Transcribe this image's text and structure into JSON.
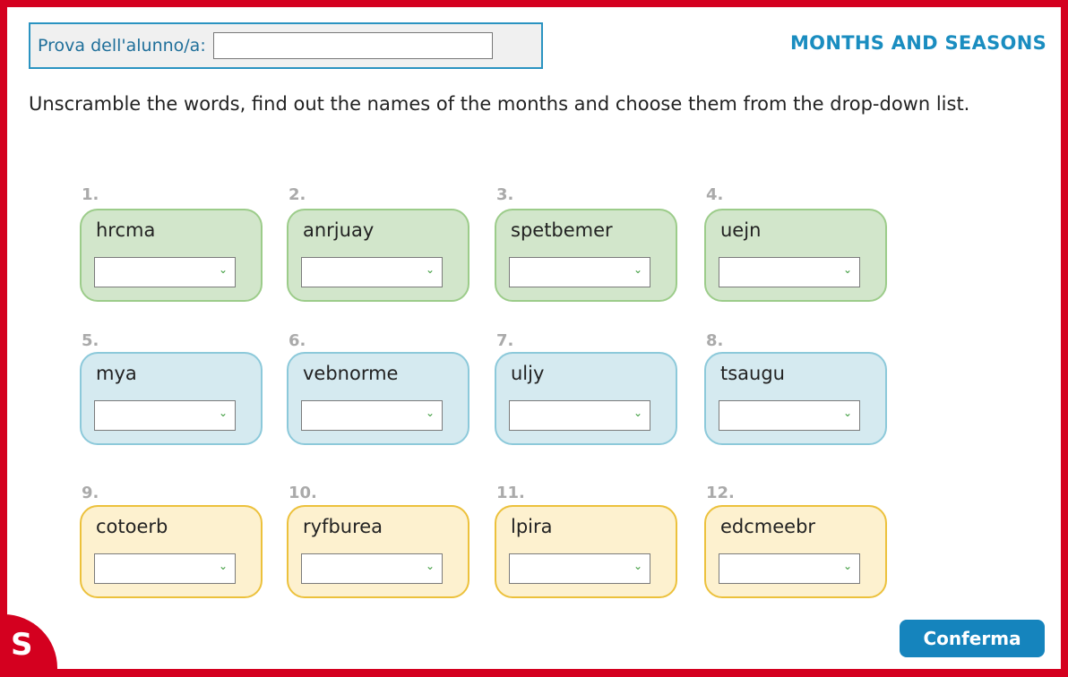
{
  "header": {
    "student_label": "Prova dell'alunno/a:",
    "student_value": "",
    "title": "MONTHS AND SEASONS"
  },
  "instruction": "Unscramble the words, find out the names of the months and choose them from the drop-down list.",
  "items": [
    {
      "num": "1.",
      "word": "hrcma",
      "selected": ""
    },
    {
      "num": "2.",
      "word": "anrjuay",
      "selected": ""
    },
    {
      "num": "3.",
      "word": "spetbemer",
      "selected": ""
    },
    {
      "num": "4.",
      "word": "uejn",
      "selected": ""
    },
    {
      "num": "5.",
      "word": "mya",
      "selected": ""
    },
    {
      "num": "6.",
      "word": "vebnorme",
      "selected": ""
    },
    {
      "num": "7.",
      "word": "uljy",
      "selected": ""
    },
    {
      "num": "8.",
      "word": "tsaugu",
      "selected": ""
    },
    {
      "num": "9.",
      "word": "cotoerb",
      "selected": ""
    },
    {
      "num": "10.",
      "word": "ryfburea",
      "selected": ""
    },
    {
      "num": "11.",
      "word": "lpira",
      "selected": ""
    },
    {
      "num": "12.",
      "word": "edcmeebr",
      "selected": ""
    }
  ],
  "footer": {
    "logo_letter": "S",
    "confirm_label": "Conferma"
  },
  "colors": {
    "frame": "#d4001f",
    "accent": "#1a8dc0",
    "green_card": "#d2e6cb",
    "blue_card": "#d5eaf0",
    "yellow_card": "#fdf1cf"
  }
}
